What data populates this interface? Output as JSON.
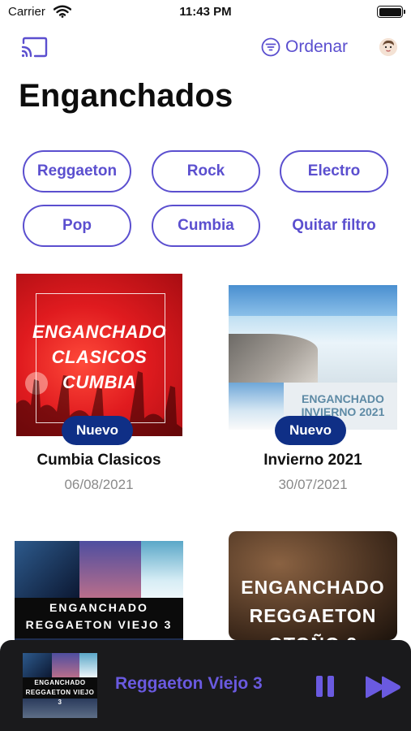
{
  "status_bar": {
    "carrier": "Carrier",
    "time": "11:43 PM"
  },
  "nav": {
    "sort_label": "Ordenar",
    "cast_icon": "cast-icon",
    "sort_icon": "filter-lines-icon",
    "avatar_icon": "avatar"
  },
  "page": {
    "title": "Enganchados"
  },
  "filters": {
    "chips": [
      "Reggaeton",
      "Rock",
      "Electro",
      "Pop",
      "Cumbia"
    ],
    "clear_label": "Quitar filtro"
  },
  "cards": [
    {
      "cover_text_lines": [
        "ENGANCHADO",
        "CLASICOS",
        "CUMBIA"
      ],
      "badge": "Nuevo",
      "title": "Cumbia Clasicos",
      "date": "06/08/2021"
    },
    {
      "cover_text_lines": [
        "ENGANCHADO",
        "INVIERNO 2021"
      ],
      "badge": "Nuevo",
      "title": "Invierno 2021",
      "date": "30/07/2021"
    },
    {
      "cover_text_lines": [
        "ENGANCHADO",
        "REGGAETON VIEJO 3"
      ]
    },
    {
      "cover_text_lines": [
        "ENGANCHADO",
        "REGGAETON",
        "OTOÑO 2"
      ]
    }
  ],
  "player": {
    "art_text_lines": [
      "ENGANCHADO",
      "REGGAETON VIEJO 3"
    ],
    "title": "Reggaeton Viejo 3"
  },
  "colors": {
    "accent": "#5b4fcf",
    "badge": "#0f2f86",
    "player_bg": "#1a1a1c",
    "player_accent": "#6a5ae0"
  }
}
